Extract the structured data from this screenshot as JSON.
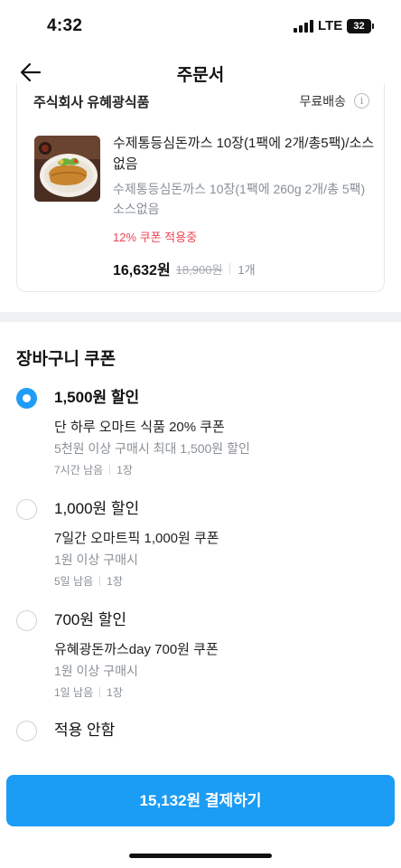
{
  "status_bar": {
    "time": "4:32",
    "network": "LTE",
    "battery": "32"
  },
  "nav": {
    "title": "주문서",
    "back_icon": "arrow-left-icon"
  },
  "order": {
    "seller": "주식회사 유혜광식품",
    "shipping": "무료배송",
    "info_icon": "i",
    "product": {
      "title": "수제통등심돈까스 10장(1팩에 2개/총5팩)/소스없음",
      "option": "수제통등심돈까스 10장(1팩에 260g 2개/총 5팩)소스없음",
      "coupon_status": "12% 쿠폰 적용중",
      "price": "16,632원",
      "original_price": "18,900원",
      "quantity": "1개"
    }
  },
  "coupons": {
    "title": "장바구니 쿠폰",
    "items": [
      {
        "amount": "1,500원 할인",
        "name": "단 하루 오마트 식품 20% 쿠폰",
        "condition": "5천원 이상 구매시 최대 1,500원 할인",
        "remaining": "7시간 남음",
        "count": "1장",
        "selected": true
      },
      {
        "amount": "1,000원 할인",
        "name": "7일간 오마트픽 1,000원 쿠폰",
        "condition": "1원 이상 구매시",
        "remaining": "5일 남음",
        "count": "1장",
        "selected": false
      },
      {
        "amount": "700원 할인",
        "name": "유혜광돈까스day 700원 쿠폰",
        "condition": "1원 이상 구매시",
        "remaining": "1일 남음",
        "count": "1장",
        "selected": false
      }
    ],
    "none_option": "적용 안함"
  },
  "pay_button": "15,132원 결제하기",
  "colors": {
    "primary": "#1b9cf5",
    "discount_red": "#f04452",
    "muted": "#8a9097"
  }
}
